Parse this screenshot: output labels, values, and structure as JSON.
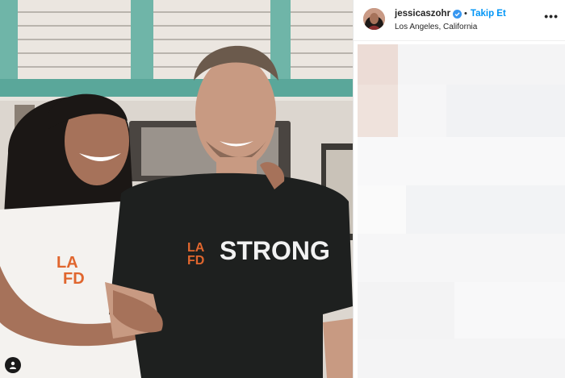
{
  "post": {
    "username": "jessicaszohr",
    "separator": "•",
    "follow_label": "Takip Et",
    "location": "Los Angeles, California",
    "more_label": "•••"
  },
  "photo": {
    "shirt_text_left": "LA",
    "shirt_text_left2": "FD",
    "shirt_text_main": "STRONG",
    "shirt2_text": "LA",
    "shirt2_text2": "FD"
  },
  "colors": {
    "follow": "#0095f6",
    "verified": "#3897f0",
    "text": "#262626"
  },
  "icons": [
    "verified-badge-icon",
    "user-tag-icon",
    "more-options-icon"
  ]
}
